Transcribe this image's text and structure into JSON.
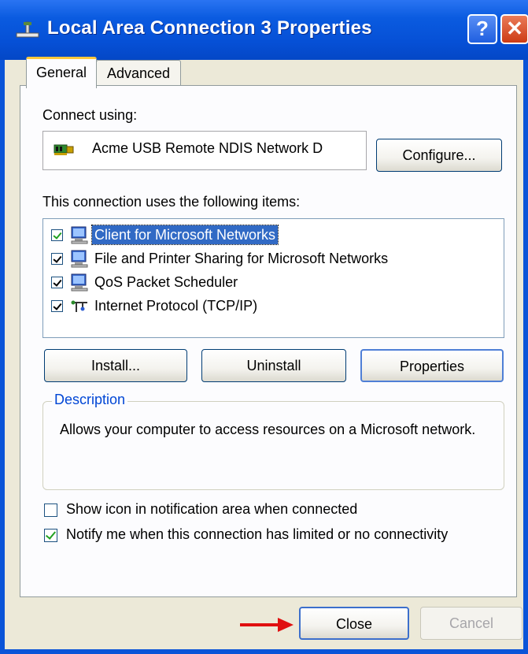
{
  "window": {
    "title": "Local Area Connection 3 Properties",
    "help_glyph": "?",
    "close_glyph": "✕"
  },
  "tabs": [
    {
      "label": "General",
      "active": true
    },
    {
      "label": "Advanced",
      "active": false
    }
  ],
  "general": {
    "connect_using_label": "Connect using:",
    "adapter_name": "Acme USB Remote NDIS Network D",
    "configure_button": "Configure...",
    "items_label": "This connection uses the following items:",
    "items": [
      {
        "label": "Client for Microsoft Networks",
        "checked": true,
        "selected": true,
        "icon": "network-client-icon"
      },
      {
        "label": "File and Printer Sharing for Microsoft Networks",
        "checked": true,
        "selected": false,
        "icon": "file-printer-sharing-icon"
      },
      {
        "label": "QoS Packet Scheduler",
        "checked": true,
        "selected": false,
        "icon": "qos-scheduler-icon"
      },
      {
        "label": "Internet Protocol (TCP/IP)",
        "checked": true,
        "selected": false,
        "icon": "protocol-icon"
      }
    ],
    "install_button": "Install...",
    "uninstall_button": "Uninstall",
    "properties_button": "Properties",
    "description_title": "Description",
    "description_text": "Allows your computer to access resources on a Microsoft network.",
    "show_icon_label": "Show icon in notification area when connected",
    "show_icon_checked": false,
    "notify_label": "Notify me when this connection has limited or no connectivity",
    "notify_checked": true
  },
  "footer": {
    "close_button": "Close",
    "cancel_button": "Cancel",
    "cancel_disabled": true
  },
  "colors": {
    "titlebar": "#0a5be0",
    "selection": "#316ac5",
    "group_title": "#0046d5",
    "arrow": "#e01010"
  }
}
